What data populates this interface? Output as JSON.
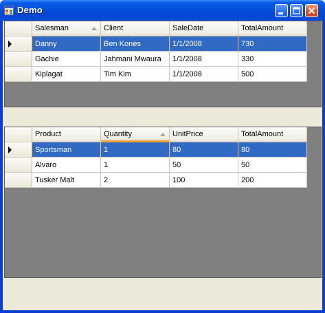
{
  "window": {
    "title": "Demo",
    "minimize_icon": "minimize-icon",
    "maximize_icon": "maximize-icon",
    "close_icon": "close-icon",
    "app_icon": "window-app-icon"
  },
  "grid_top": {
    "columns": [
      "Salesman",
      "Client",
      "SaleDate",
      "TotalAmount"
    ],
    "sorted_column": "Salesman",
    "rows": [
      [
        "Danny",
        "Ben Kones",
        "1/1/2008",
        "730"
      ],
      [
        "Gachie",
        "Jahmani Mwaura",
        "1/1/2008",
        "330"
      ],
      [
        "Kiplagat",
        "Tim Kim",
        "1/1/2008",
        "500"
      ]
    ],
    "selected_row": 0
  },
  "grid_bottom": {
    "columns": [
      "Product",
      "Quantity",
      "UnitPrice",
      "TotalAmount"
    ],
    "sorted_column": "Quantity",
    "rows": [
      [
        "Sportsman",
        "1",
        "80",
        "80"
      ],
      [
        "Alvaro",
        "1",
        "50",
        "50"
      ],
      [
        "Tusker Malt",
        "2",
        "100",
        "200"
      ]
    ],
    "selected_row": 0
  },
  "colors": {
    "title_bar": "#0450dc",
    "selection": "#316ac5",
    "grid_background": "#808080",
    "form_background": "#ece9d8",
    "sort_underline": "#f0a43a"
  }
}
